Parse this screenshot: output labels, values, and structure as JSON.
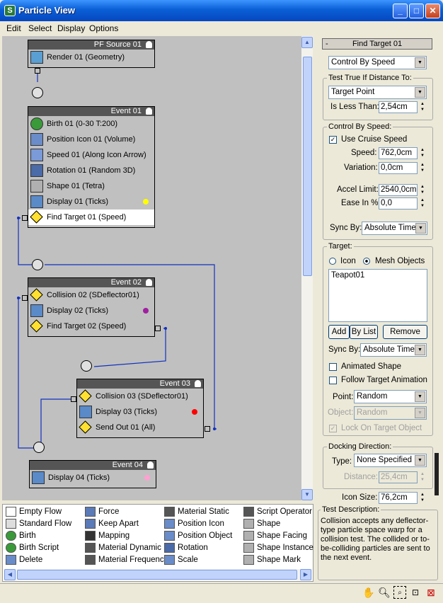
{
  "window": {
    "title": "Particle View",
    "icon_letter": "S"
  },
  "menu": [
    "Edit",
    "Select",
    "Display",
    "Options"
  ],
  "events": {
    "pf_source": {
      "title": "PF Source 01",
      "ops": [
        "Render 01 (Geometry)"
      ]
    },
    "event01": {
      "title": "Event 01",
      "ops": [
        "Birth 01 (0-30 T:200)",
        "Position Icon 01 (Volume)",
        "Speed 01 (Along Icon Arrow)",
        "Rotation 01 (Random 3D)",
        "Shape 01 (Tetra)",
        "Display 01 (Ticks)",
        "Find Target 01 (Speed)"
      ]
    },
    "event02": {
      "title": "Event 02",
      "ops": [
        "Collision 02 (SDeflector01)",
        "Display 02 (Ticks)",
        "Find Target 02 (Speed)"
      ]
    },
    "event03": {
      "title": "Event 03",
      "ops": [
        "Collision 03 (SDeflector01)",
        "Display 03 (Ticks)",
        "Send Out 01 (All)"
      ]
    },
    "event04": {
      "title": "Event 04",
      "ops": [
        "Display 04 (Ticks)"
      ]
    }
  },
  "display_colors": {
    "event01": "#ffff00",
    "event02": "#a020a0",
    "event03": "#ff0000",
    "event04": "#ffa0d0"
  },
  "depot": [
    [
      "Empty Flow",
      "Standard Flow",
      "Birth",
      "Birth Script",
      "Delete"
    ],
    [
      "Force",
      "Keep Apart",
      "Mapping",
      "Material Dynamic",
      "Material Frequency"
    ],
    [
      "Material Static",
      "Position Icon",
      "Position Object",
      "Rotation",
      "Scale"
    ],
    [
      "Script Operator",
      "Shape",
      "Shape Facing",
      "Shape Instance",
      "Shape Mark"
    ]
  ],
  "panel": {
    "rollout_title": "Find Target 01",
    "rollout_minus": "-",
    "mode": "Control By Speed",
    "test_group": "Test True If Distance To:",
    "test_target": "Target Point",
    "less_than_label": "Is Less Than:",
    "less_than_value": "2,54cm",
    "speed_group": "Control By Speed:",
    "use_cruise": "Use Cruise Speed",
    "speed_label": "Speed:",
    "speed_value": "762,0cm",
    "variation_label": "Variation:",
    "variation_value": "0,0cm",
    "accel_label": "Accel Limit:",
    "accel_value": "2540,0cm",
    "ease_label": "Ease In %",
    "ease_value": "0,0",
    "sync_label": "Sync By:",
    "sync_value": "Absolute Time",
    "target_group": "Target:",
    "icon_radio": "Icon",
    "mesh_radio": "Mesh Objects",
    "target_list": [
      "Teapot01"
    ],
    "add_btn": "Add",
    "bylist_btn": "By List",
    "remove_btn": "Remove",
    "sync2_label": "Sync By:",
    "sync2_value": "Absolute Time",
    "animated_shape": "Animated Shape",
    "follow_anim": "Follow Target Animation",
    "point_label": "Point:",
    "point_value": "Random",
    "object_label": "Object:",
    "object_value": "Random",
    "lock_on": "Lock On Target Object",
    "docking_group": "Docking Direction:",
    "type_label": "Type:",
    "type_value": "None Specified",
    "distance_label": "Distance:",
    "distance_value": "25,4cm",
    "icon_size_label": "Icon Size:",
    "icon_size_value": "76,2cm"
  },
  "description": {
    "title": "Test Description:",
    "text": "Collision accepts any deflector-type particle space warp for a collision test. The collided or to-be-colliding particles are sent to the next event."
  },
  "toolbar_icons": [
    "pan-icon",
    "zoom-icon",
    "zoom-region-icon",
    "zoom-extents-icon",
    "no-zoom-icon"
  ]
}
